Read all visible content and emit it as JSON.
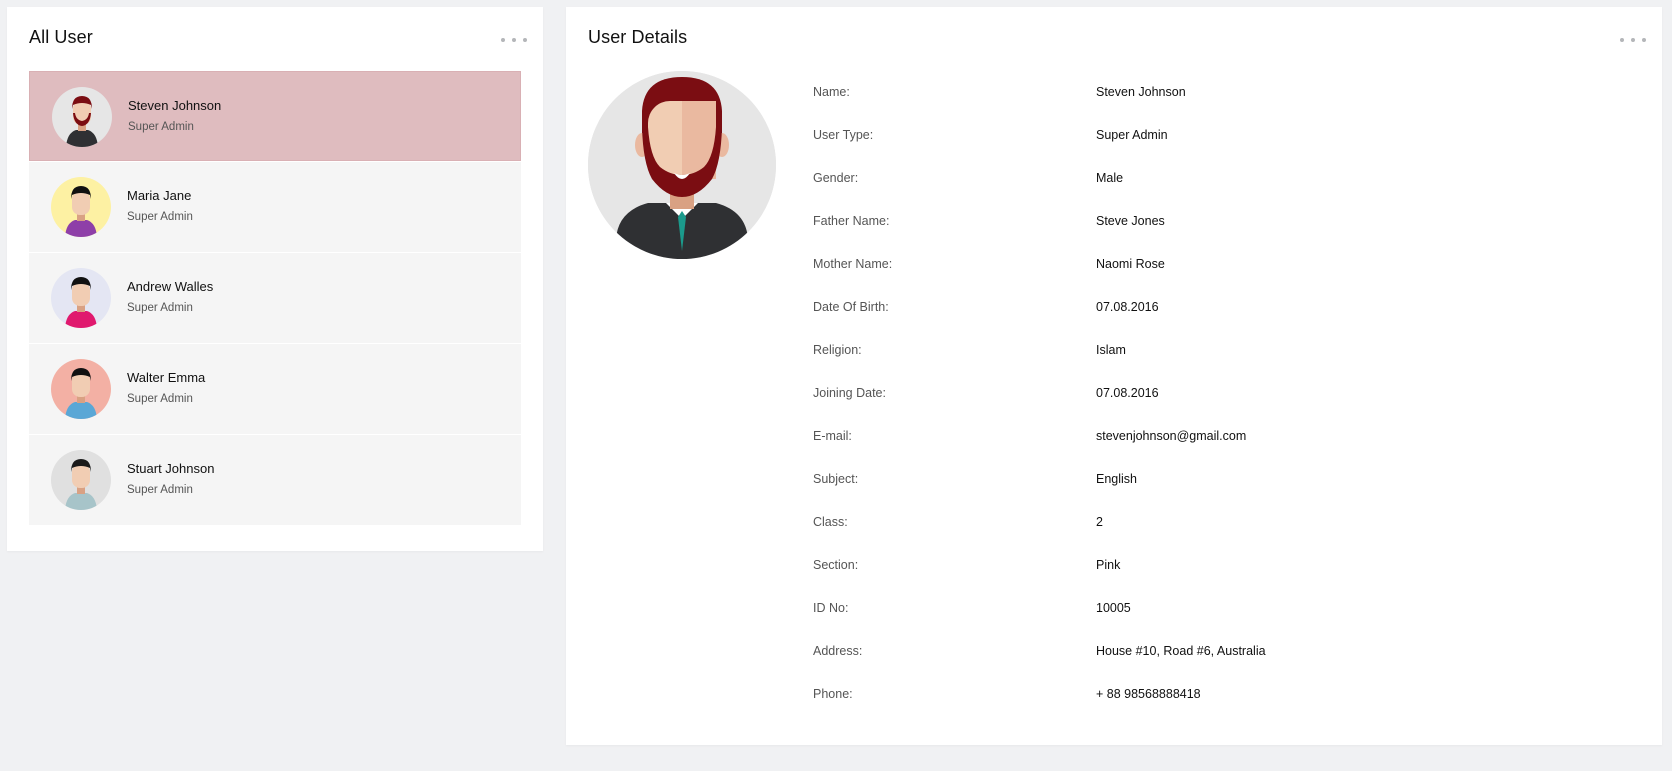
{
  "all_user": {
    "title": "All User",
    "users": [
      {
        "name": "Steven Johnson",
        "role": "Super Admin",
        "avatar_bg": "#e6e6e6",
        "active": true
      },
      {
        "name": "Maria Jane",
        "role": "Super Admin",
        "avatar_bg": "#fdf1a3",
        "active": false
      },
      {
        "name": "Andrew Walles",
        "role": "Super Admin",
        "avatar_bg": "#e4e6f3",
        "active": false
      },
      {
        "name": "Walter Emma",
        "role": "Super Admin",
        "avatar_bg": "#f3b0a4",
        "active": false
      },
      {
        "name": "Stuart Johnson",
        "role": "Super Admin",
        "avatar_bg": "#e0e0e0",
        "active": false
      }
    ]
  },
  "user_details": {
    "title": "User Details",
    "fields": [
      {
        "label": "Name:",
        "value": "Steven Johnson"
      },
      {
        "label": "User Type:",
        "value": "Super Admin"
      },
      {
        "label": "Gender:",
        "value": "Male"
      },
      {
        "label": "Father Name:",
        "value": "Steve Jones"
      },
      {
        "label": "Mother Name:",
        "value": "Naomi Rose"
      },
      {
        "label": "Date Of Birth:",
        "value": "07.08.2016"
      },
      {
        "label": "Religion:",
        "value": "Islam"
      },
      {
        "label": "Joining Date:",
        "value": "07.08.2016"
      },
      {
        "label": "E-mail:",
        "value": "stevenjohnson@gmail.com"
      },
      {
        "label": "Subject:",
        "value": "English"
      },
      {
        "label": "Class:",
        "value": "2"
      },
      {
        "label": "Section:",
        "value": "Pink"
      },
      {
        "label": "ID No:",
        "value": "10005"
      },
      {
        "label": "Address:",
        "value": "House #10, Road #6, Australia"
      },
      {
        "label": "Phone:",
        "value": "+ 88 98568888418"
      }
    ]
  },
  "icons": {
    "more": "more-horizontal-icon",
    "avatar": "user-avatar-icon"
  },
  "colors": {
    "active_row": "#dfbcbf",
    "row": "#f5f5f5",
    "page_bg": "#f0f1f3"
  }
}
